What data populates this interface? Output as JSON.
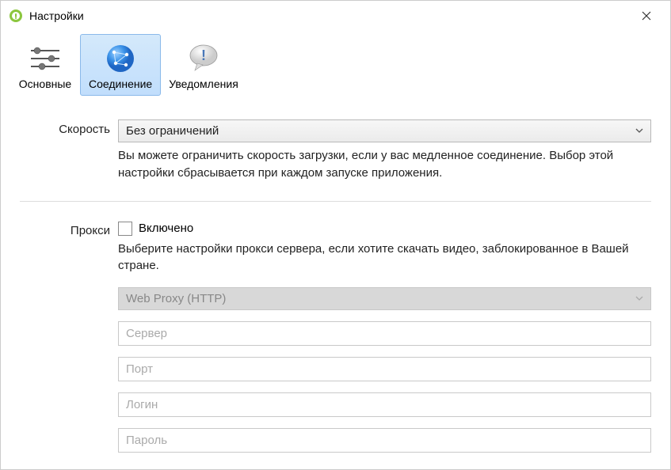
{
  "window": {
    "title": "Настройки"
  },
  "tabs": {
    "general": "Основные",
    "connection": "Соединение",
    "notifications": "Уведомления",
    "selected": "connection"
  },
  "speed": {
    "label": "Скорость",
    "value": "Без ограничений",
    "help": "Вы можете ограничить скорость загрузки, если у вас медленное соединение. Выбор этой настройки сбрасывается при каждом запуске приложения."
  },
  "proxy": {
    "label": "Прокси",
    "enabled_label": "Включено",
    "enabled": false,
    "help": "Выберите настройки прокси сервера, если хотите скачать видео, заблокированное в Вашей стране.",
    "type": "Web Proxy (HTTP)",
    "server_placeholder": "Сервер",
    "port_placeholder": "Порт",
    "login_placeholder": "Логин",
    "password_placeholder": "Пароль",
    "server": "",
    "port": "",
    "login": "",
    "password": ""
  }
}
